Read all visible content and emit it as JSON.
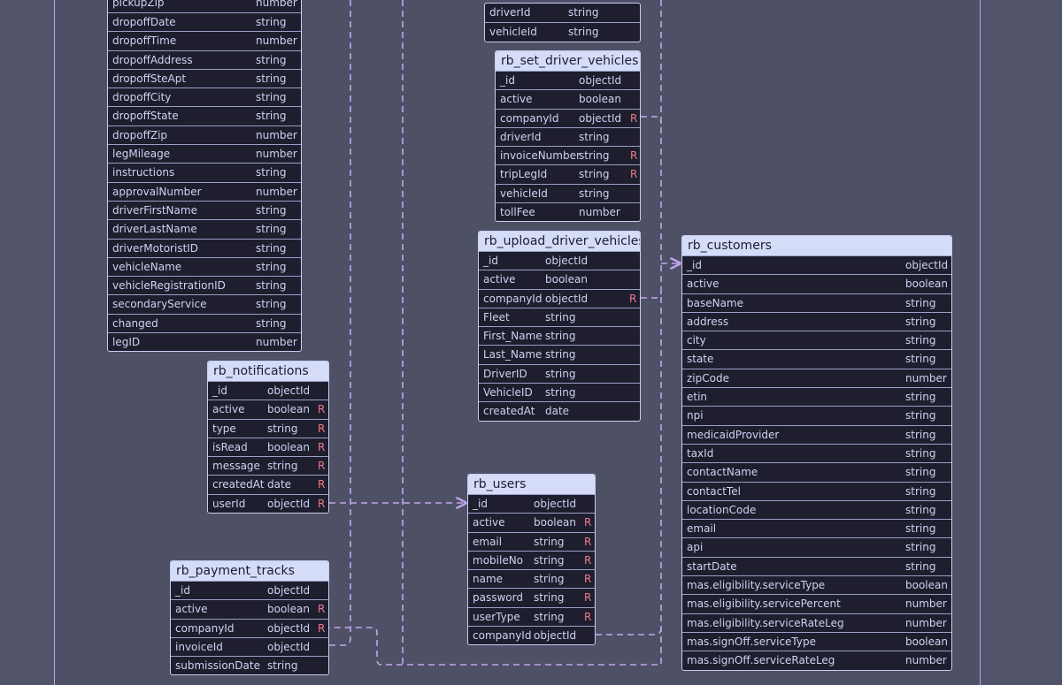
{
  "diagram": {
    "tables": [
      {
        "id": "rb_trip_legs",
        "title": "",
        "fields": [
          {
            "name": "pickupZip",
            "type": "number",
            "req": ""
          },
          {
            "name": "dropoffDate",
            "type": "string",
            "req": ""
          },
          {
            "name": "dropoffTime",
            "type": "number",
            "req": ""
          },
          {
            "name": "dropoffAddress",
            "type": "string",
            "req": ""
          },
          {
            "name": "dropoffSteApt",
            "type": "string",
            "req": ""
          },
          {
            "name": "dropoffCity",
            "type": "string",
            "req": ""
          },
          {
            "name": "dropoffState",
            "type": "string",
            "req": ""
          },
          {
            "name": "dropoffZip",
            "type": "number",
            "req": ""
          },
          {
            "name": "legMileage",
            "type": "number",
            "req": ""
          },
          {
            "name": "instructions",
            "type": "string",
            "req": ""
          },
          {
            "name": "approvalNumber",
            "type": "number",
            "req": ""
          },
          {
            "name": "driverFirstName",
            "type": "string",
            "req": ""
          },
          {
            "name": "driverLastName",
            "type": "string",
            "req": ""
          },
          {
            "name": "driverMotoristID",
            "type": "string",
            "req": ""
          },
          {
            "name": "vehicleName",
            "type": "string",
            "req": ""
          },
          {
            "name": "vehicleRegistrationID",
            "type": "string",
            "req": ""
          },
          {
            "name": "secondaryService",
            "type": "string",
            "req": ""
          },
          {
            "name": "changed",
            "type": "string",
            "req": ""
          },
          {
            "name": "legID",
            "type": "number",
            "req": ""
          }
        ]
      },
      {
        "id": "rb_top_partial",
        "title": "",
        "fields": [
          {
            "name": "driverId",
            "type": "string",
            "req": ""
          },
          {
            "name": "vehicleId",
            "type": "string",
            "req": ""
          }
        ]
      },
      {
        "id": "rb_set_driver_vehicles",
        "title": "rb_set_driver_vehicles",
        "fields": [
          {
            "name": "_id",
            "type": "objectId",
            "req": ""
          },
          {
            "name": "active",
            "type": "boolean",
            "req": ""
          },
          {
            "name": "companyId",
            "type": "objectId",
            "req": "R"
          },
          {
            "name": "driverId",
            "type": "string",
            "req": ""
          },
          {
            "name": "invoiceNumber",
            "type": "string",
            "req": "R"
          },
          {
            "name": "tripLegId",
            "type": "string",
            "req": "R"
          },
          {
            "name": "vehicleId",
            "type": "string",
            "req": ""
          },
          {
            "name": "tollFee",
            "type": "number",
            "req": ""
          }
        ]
      },
      {
        "id": "rb_upload_driver_vehicles",
        "title": "rb_upload_driver_vehicles",
        "fields": [
          {
            "name": "_id",
            "type": "objectId",
            "req": ""
          },
          {
            "name": "active",
            "type": "boolean",
            "req": ""
          },
          {
            "name": "companyId",
            "type": "objectId",
            "req": "R"
          },
          {
            "name": "Fleet",
            "type": "string",
            "req": ""
          },
          {
            "name": "First_Name",
            "type": "string",
            "req": ""
          },
          {
            "name": "Last_Name",
            "type": "string",
            "req": ""
          },
          {
            "name": "DriverID",
            "type": "string",
            "req": ""
          },
          {
            "name": "VehicleID",
            "type": "string",
            "req": ""
          },
          {
            "name": "createdAt",
            "type": "date",
            "req": ""
          }
        ]
      },
      {
        "id": "rb_notifications",
        "title": "rb_notifications",
        "fields": [
          {
            "name": "_id",
            "type": "objectId",
            "req": ""
          },
          {
            "name": "active",
            "type": "boolean",
            "req": "R"
          },
          {
            "name": "type",
            "type": "string",
            "req": "R"
          },
          {
            "name": "isRead",
            "type": "boolean",
            "req": "R"
          },
          {
            "name": "message",
            "type": "string",
            "req": "R"
          },
          {
            "name": "createdAt",
            "type": "date",
            "req": "R"
          },
          {
            "name": "userId",
            "type": "objectId",
            "req": "R"
          }
        ]
      },
      {
        "id": "rb_users",
        "title": "rb_users",
        "fields": [
          {
            "name": "_id",
            "type": "objectId",
            "req": ""
          },
          {
            "name": "active",
            "type": "boolean",
            "req": "R"
          },
          {
            "name": "email",
            "type": "string",
            "req": "R"
          },
          {
            "name": "mobileNo",
            "type": "string",
            "req": "R"
          },
          {
            "name": "name",
            "type": "string",
            "req": "R"
          },
          {
            "name": "password",
            "type": "string",
            "req": "R"
          },
          {
            "name": "userType",
            "type": "string",
            "req": "R"
          },
          {
            "name": "companyId",
            "type": "objectId",
            "req": ""
          }
        ]
      },
      {
        "id": "rb_payment_tracks",
        "title": "rb_payment_tracks",
        "fields": [
          {
            "name": "_id",
            "type": "objectId",
            "req": ""
          },
          {
            "name": "active",
            "type": "boolean",
            "req": "R"
          },
          {
            "name": "companyId",
            "type": "objectId",
            "req": "R"
          },
          {
            "name": "invoiceId",
            "type": "objectId",
            "req": ""
          },
          {
            "name": "submissionDate",
            "type": "string",
            "req": ""
          }
        ]
      },
      {
        "id": "rb_customers",
        "title": "rb_customers",
        "fields": [
          {
            "name": "_id",
            "type": "objectId",
            "req": ""
          },
          {
            "name": "active",
            "type": "boolean",
            "req": ""
          },
          {
            "name": "baseName",
            "type": "string",
            "req": ""
          },
          {
            "name": "address",
            "type": "string",
            "req": ""
          },
          {
            "name": "city",
            "type": "string",
            "req": ""
          },
          {
            "name": "state",
            "type": "string",
            "req": ""
          },
          {
            "name": "zipCode",
            "type": "number",
            "req": ""
          },
          {
            "name": "etin",
            "type": "string",
            "req": ""
          },
          {
            "name": "npi",
            "type": "string",
            "req": ""
          },
          {
            "name": "medicaidProvider",
            "type": "string",
            "req": ""
          },
          {
            "name": "taxId",
            "type": "string",
            "req": ""
          },
          {
            "name": "contactName",
            "type": "string",
            "req": ""
          },
          {
            "name": "contactTel",
            "type": "string",
            "req": ""
          },
          {
            "name": "locationCode",
            "type": "string",
            "req": ""
          },
          {
            "name": "email",
            "type": "string",
            "req": ""
          },
          {
            "name": "api",
            "type": "string",
            "req": ""
          },
          {
            "name": "startDate",
            "type": "string",
            "req": ""
          },
          {
            "name": "mas.eligibility.serviceType",
            "type": "boolean",
            "req": ""
          },
          {
            "name": "mas.eligibility.servicePercent",
            "type": "number",
            "req": ""
          },
          {
            "name": "mas.eligibility.serviceRateLeg",
            "type": "number",
            "req": ""
          },
          {
            "name": "mas.signOff.serviceType",
            "type": "boolean",
            "req": ""
          },
          {
            "name": "mas.signOff.serviceRateLeg",
            "type": "number",
            "req": ""
          }
        ]
      }
    ]
  },
  "colors": {
    "background": "#51536a",
    "table_body": "#1e1e2e",
    "table_header": "#d4dcf8",
    "text": "#ccd4f2",
    "required_marker": "#f07a8a",
    "edge": "#c2a5f0"
  }
}
